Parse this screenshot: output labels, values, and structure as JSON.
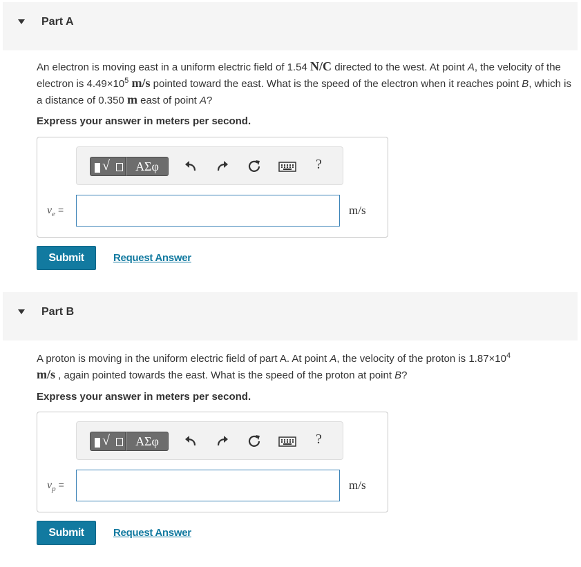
{
  "part_a": {
    "title": "Part A",
    "question_seg1": "An electron is moving east in a uniform electric field of 1.54 ",
    "field_unit": "N/C",
    "question_seg2": " directed to the west. At point ",
    "point_a": "A",
    "question_seg3": ", the velocity of the electron is 4.49×10",
    "velocity_exp": "5",
    "velocity_unit": "m/s",
    "question_seg4": " pointed toward the east. What is the speed of the electron when it reaches point ",
    "point_b": "B",
    "question_seg5": ", which is a distance of 0.350 ",
    "distance_unit": "m",
    "question_seg6": " east of point ",
    "point_a2": "A",
    "question_seg7": "?",
    "instruction": "Express your answer in meters per second.",
    "variable": "v",
    "variable_sub": "e",
    "equals": "=",
    "input_value": "",
    "unit": "m/s",
    "submit_label": "Submit",
    "request_label": "Request Answer"
  },
  "part_b": {
    "title": "Part B",
    "question_seg1": "A proton is moving in the uniform electric field of part A. At point ",
    "point_a": "A",
    "question_seg2": ", the velocity of the proton is 1.87×10",
    "velocity_exp": "4",
    "velocity_unit": "m/s",
    "question_seg3": " , again pointed towards the east. What is the speed of the proton at point ",
    "point_b": "B",
    "question_seg4": "?",
    "instruction": "Express your answer in meters per second.",
    "variable": "v",
    "variable_sub": "p",
    "equals": "=",
    "input_value": "",
    "unit": "m/s",
    "submit_label": "Submit",
    "request_label": "Request Answer"
  },
  "toolbar": {
    "greek_label": "ΑΣφ",
    "help_label": "?",
    "icons": [
      "templates-icon",
      "greek-letters-icon",
      "undo-icon",
      "redo-icon",
      "reset-icon",
      "keyboard-icon",
      "help-icon"
    ]
  },
  "colors": {
    "accent": "#127aa0",
    "header_bg": "#f5f5f5",
    "input_border": "#3e84b8",
    "toolbar_button": "#6d6d6d"
  }
}
